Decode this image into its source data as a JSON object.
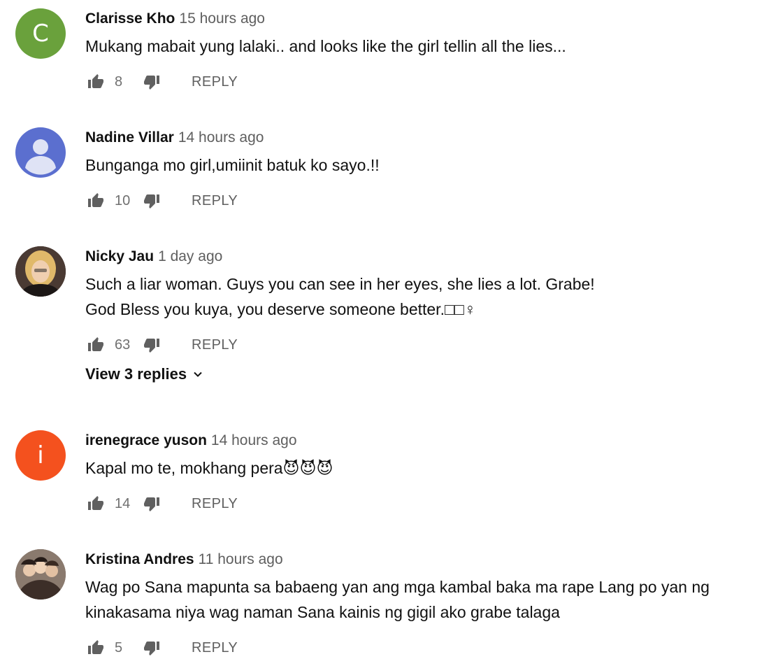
{
  "comments": [
    {
      "author": "Clarisse Kho",
      "time": "15 hours ago",
      "lines": [
        "Mukang mabait yung lalaki.. and looks like the girl tellin all the lies..."
      ],
      "likes": "8",
      "reply_label": "REPLY",
      "avatar": {
        "type": "letter",
        "letter": "C",
        "color": "#6aa13c"
      }
    },
    {
      "author": "Nadine Villar",
      "time": "14 hours ago",
      "lines": [
        "Bunganga mo girl,umiinit batuk ko sayo.!!"
      ],
      "likes": "10",
      "reply_label": "REPLY",
      "avatar": {
        "type": "default",
        "color": "#5b6fcf"
      }
    },
    {
      "author": "Nicky Jau",
      "time": "1 day ago",
      "lines": [
        "Such a liar woman. Guys you can see in her eyes, she lies a lot. Grabe!",
        "God Bless you kuya, you deserve someone better.□□♀"
      ],
      "likes": "63",
      "reply_label": "REPLY",
      "view_replies": "View 3 replies",
      "avatar": {
        "type": "photo",
        "color": "#c89a6a"
      }
    },
    {
      "author": "irenegrace yuson",
      "time": "14 hours ago",
      "lines": [
        "Kapal mo te, mokhang pera😈😈😈"
      ],
      "likes": "14",
      "reply_label": "REPLY",
      "avatar": {
        "type": "letter",
        "letter": "i",
        "color": "#f4511e"
      }
    },
    {
      "author": "Kristina Andres",
      "time": "11 hours ago",
      "lines": [
        "Wag po Sana mapunta sa babaeng yan ang mga kambal baka ma rape Lang po yan ng",
        "kinakasama niya wag naman Sana kainis ng gigil ako grabe talaga"
      ],
      "likes": "5",
      "reply_label": "REPLY",
      "avatar": {
        "type": "group",
        "color": "#7a6a5e"
      }
    }
  ]
}
